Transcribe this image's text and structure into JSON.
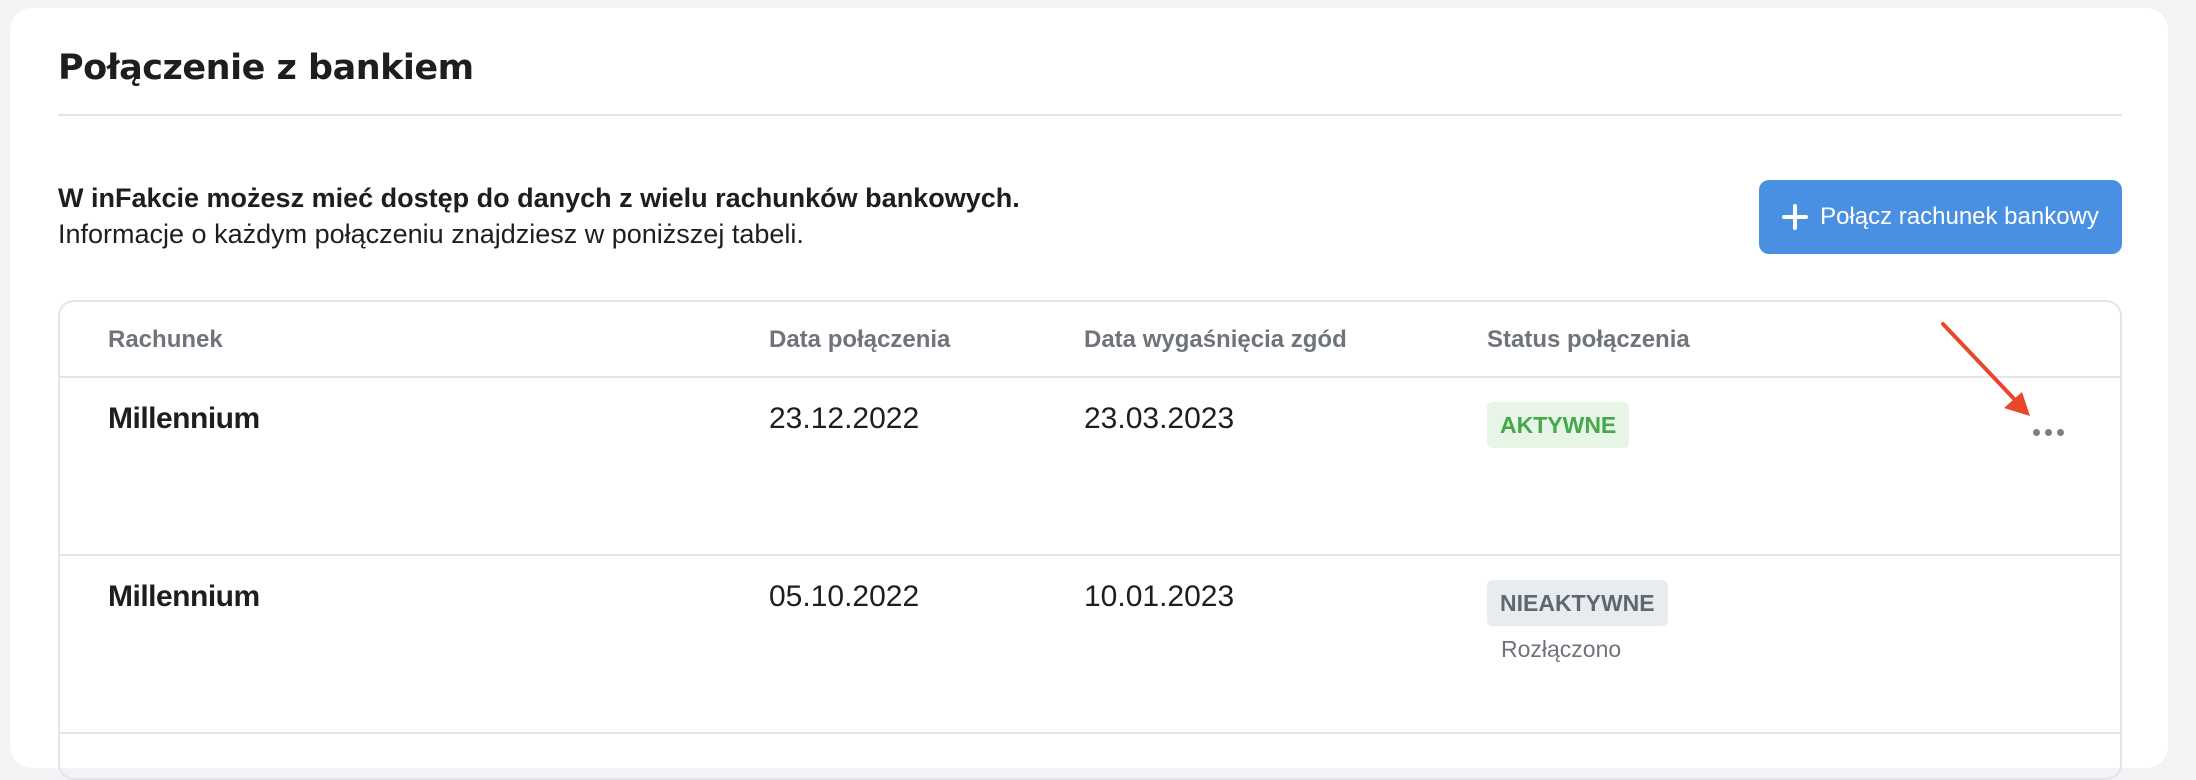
{
  "page": {
    "title": "Połączenie z bankiem"
  },
  "intro": {
    "line1": "W inFakcie możesz mieć dostęp do danych z wielu rachunków bankowych.",
    "line2": "Informacje o każdym połączeniu znajdziesz w poniższej tabeli."
  },
  "actions": {
    "connect_label": "Połącz rachunek bankowy",
    "connect_icon": "plus-icon"
  },
  "table": {
    "headers": {
      "account": "Rachunek",
      "connected_at": "Data połączenia",
      "consent_expires": "Data wygaśnięcia zgód",
      "status": "Status połączenia"
    },
    "rows": [
      {
        "account": "Millennium",
        "connected_at": "23.12.2022",
        "consent_expires": "23.03.2023",
        "status": "AKTYWNE",
        "substatus": ""
      },
      {
        "account": "Millennium",
        "connected_at": "05.10.2022",
        "consent_expires": "10.01.2023",
        "status": "NIEAKTYWNE",
        "substatus": "Rozłączono"
      }
    ],
    "row_menu_icon": "more-horizontal-icon"
  },
  "colors": {
    "primary": "#4a90e2",
    "active_text": "#45a84b",
    "active_bg": "#e7f5e7",
    "inactive_text": "#5e6872",
    "inactive_bg": "#e9ecef",
    "annotation_arrow": "#e8472a"
  }
}
